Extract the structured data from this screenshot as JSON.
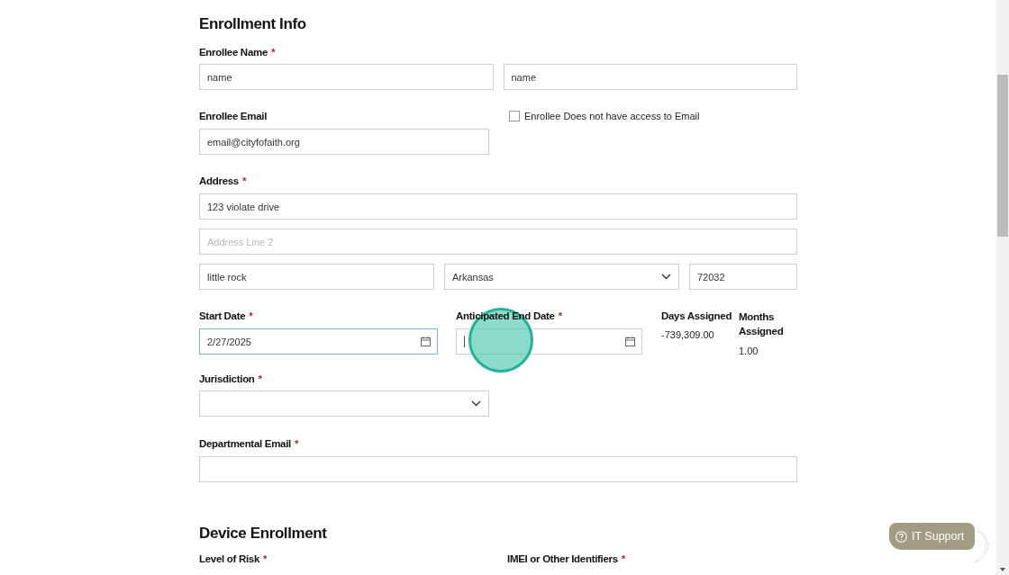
{
  "enrollment_info": {
    "title": "Enrollment Info",
    "enrollee_name": {
      "label": "Enrollee Name",
      "required_mark": "*",
      "first_value": "name",
      "last_value": "name"
    },
    "enrollee_email": {
      "label": "Enrollee Email",
      "value": "email@cityfofaith.org"
    },
    "no_email_access": {
      "label": "Enrollee Does not have access to Email",
      "checked": false
    },
    "address": {
      "label": "Address",
      "required_mark": "*",
      "line1": "123 violate drive",
      "line2_placeholder": "Address Line 2",
      "city": "little rock",
      "state": "Arkansas",
      "zip": "72032"
    },
    "start_date": {
      "label": "Start Date",
      "required_mark": "*",
      "value": "2/27/2025",
      "focused": true
    },
    "end_date": {
      "label": "Anticipated End Date",
      "required_mark": "*",
      "caret": true
    },
    "days_assigned": {
      "label": "Days Assigned",
      "value": "-739,309.00"
    },
    "months_assigned": {
      "label": "Months Assigned",
      "value": "1.00"
    },
    "jurisdiction": {
      "label": "Jurisdiction",
      "required_mark": "*"
    },
    "departmental_email": {
      "label": "Departmental Email",
      "required_mark": "*"
    }
  },
  "device_enrollment": {
    "title": "Device Enrollment",
    "level_of_risk": {
      "label": "Level of Risk",
      "required_mark": "*"
    },
    "imei": {
      "label": "IMEI or Other Identifiers",
      "required_mark": "*"
    }
  },
  "it_support": {
    "label": "IT Support"
  }
}
